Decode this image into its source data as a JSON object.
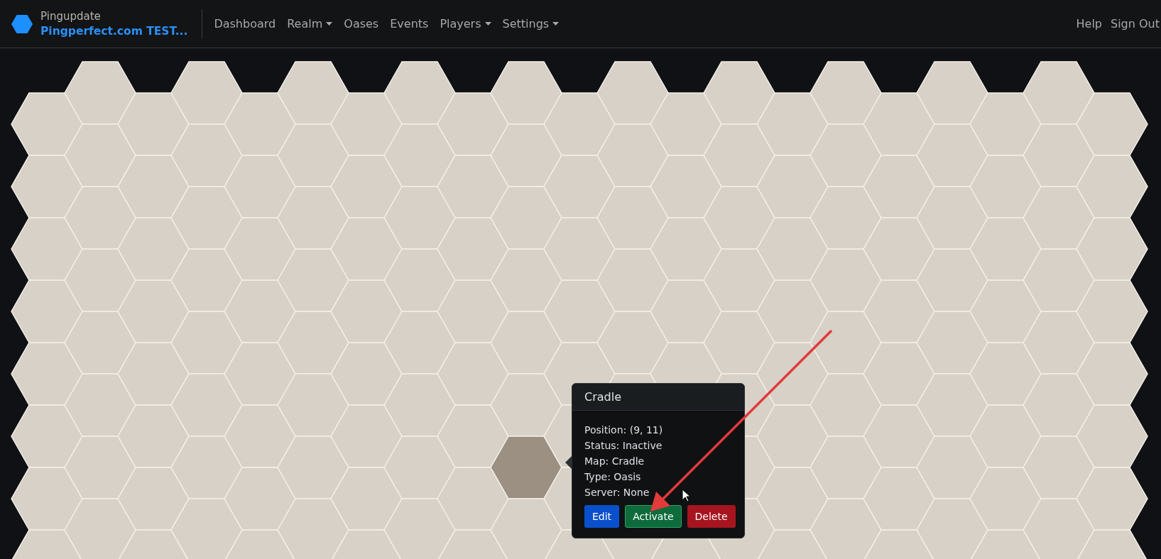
{
  "brand": {
    "name": "Pingupdate",
    "site": "Pingperfect.com TEST..."
  },
  "nav": [
    {
      "label": "Dashboard",
      "dropdown": false
    },
    {
      "label": "Realm",
      "dropdown": true
    },
    {
      "label": "Oases",
      "dropdown": false
    },
    {
      "label": "Events",
      "dropdown": false
    },
    {
      "label": "Players",
      "dropdown": true
    },
    {
      "label": "Settings",
      "dropdown": true
    }
  ],
  "nav_right": [
    "Help",
    "Sign Out"
  ],
  "popover": {
    "title": "Cradle",
    "lines": [
      "Position: (9, 11)",
      "Status: Inactive",
      "Map: Cradle",
      "Type: Oasis",
      "Server: None"
    ],
    "buttons": [
      {
        "label": "Edit",
        "kind": "primary"
      },
      {
        "label": "Activate",
        "kind": "success"
      },
      {
        "label": "Delete",
        "kind": "danger"
      }
    ]
  }
}
